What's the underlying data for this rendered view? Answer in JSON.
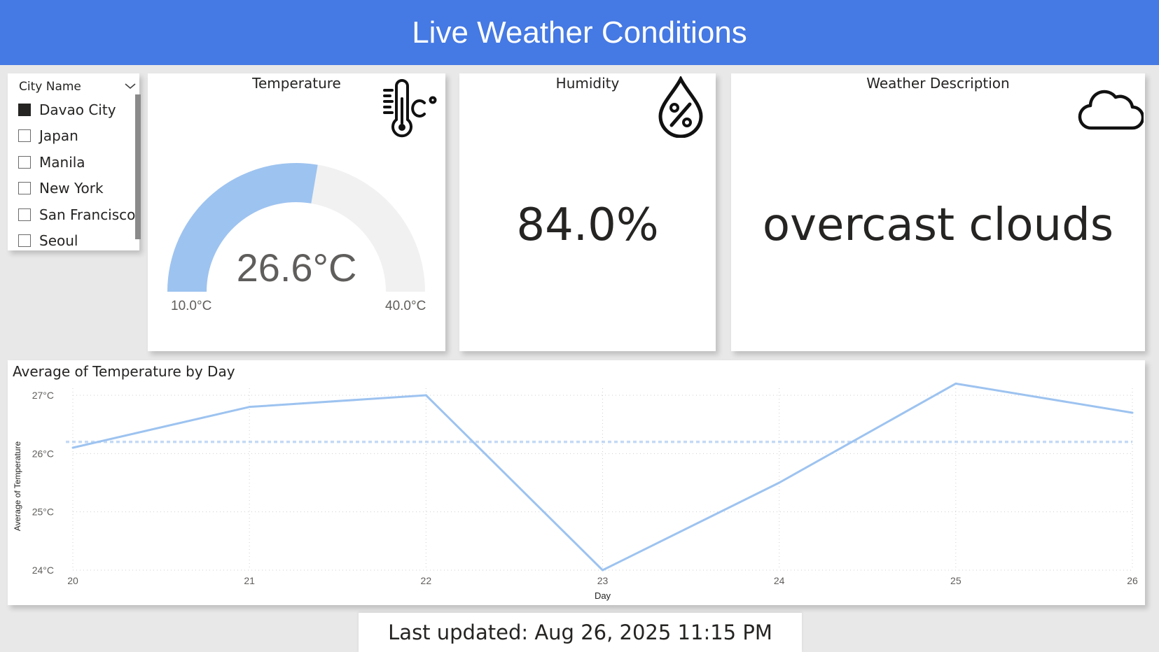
{
  "header": {
    "title": "Live Weather Conditions"
  },
  "slicer": {
    "title": "City Name",
    "items": [
      {
        "label": "Davao City",
        "checked": true
      },
      {
        "label": "Japan",
        "checked": false
      },
      {
        "label": "Manila",
        "checked": false
      },
      {
        "label": "New York",
        "checked": false
      },
      {
        "label": "San Francisco",
        "checked": false
      },
      {
        "label": "Seoul",
        "checked": false
      }
    ]
  },
  "temperature": {
    "title": "Temperature",
    "value_label": "26.6°C",
    "value": 26.6,
    "min": 10.0,
    "max": 40.0,
    "min_label": "10.0°C",
    "max_label": "40.0°C",
    "icon": "thermometer-celsius-icon",
    "fill_color": "#9dc3f0",
    "track_color": "#f1f1f1"
  },
  "humidity": {
    "title": "Humidity",
    "value": "84.0%",
    "icon": "humidity-drop-icon"
  },
  "description": {
    "title": "Weather Description",
    "value": "overcast clouds",
    "icon": "cloud-icon"
  },
  "chart_data": {
    "type": "line",
    "title": "Average of Temperature by Day",
    "xlabel": "Day",
    "ylabel": "Average of Temperature",
    "x": [
      20,
      21,
      22,
      23,
      24,
      25,
      26
    ],
    "series": [
      {
        "values": [
          26.1,
          26.8,
          27.0,
          24.0,
          25.5,
          27.2,
          26.7
        ]
      }
    ],
    "average_line": 26.2,
    "ylim": [
      24,
      27
    ],
    "y_ticks": [
      24,
      25,
      26,
      27
    ],
    "y_tick_labels": [
      "24°C",
      "25°C",
      "26°C",
      "27°C"
    ],
    "grid": true,
    "line_color": "#9dc3f0"
  },
  "footer": {
    "last_updated": "Last updated: Aug 26, 2025 11:15 PM"
  }
}
